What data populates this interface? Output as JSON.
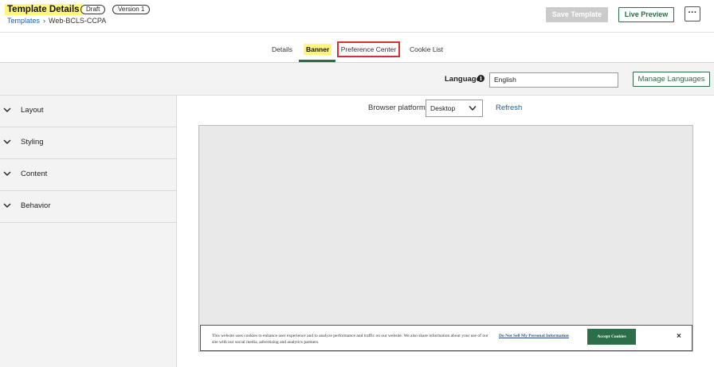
{
  "header": {
    "title": "Template Details",
    "status_badge": "Draft",
    "version_badge": "Version 1",
    "breadcrumb": {
      "parent": "Templates",
      "current": "Web-BCLS-CCPA"
    },
    "save_label": "Save Template",
    "preview_label": "Live Preview",
    "more_label": "···"
  },
  "tabs": [
    {
      "label": "Details"
    },
    {
      "label": "Banner"
    },
    {
      "label": "Preference Center"
    },
    {
      "label": "Cookie List"
    }
  ],
  "language": {
    "label": "Language",
    "value": "English",
    "manage_label": "Manage Languages"
  },
  "sidebar": {
    "items": [
      {
        "label": "Layout"
      },
      {
        "label": "Styling"
      },
      {
        "label": "Content"
      },
      {
        "label": "Behavior"
      }
    ]
  },
  "preview": {
    "platform_label": "Browser platform:",
    "platform_value": "Desktop",
    "refresh_label": "Refresh",
    "banner": {
      "text": "This website uses cookies to enhance user experience and to analyze performance and traffic on our website. We also share information about your use of our site with our social media, advertising and analytics partners.",
      "dns_link": "Do Not Sell My Personal Information",
      "accept_label": "Accept Cookies",
      "close_label": "×"
    }
  },
  "colors": {
    "accent": "#2b6e47",
    "highlight": "#fff67a",
    "link": "#1f5fa8",
    "focus_outline": "#d7312f"
  }
}
